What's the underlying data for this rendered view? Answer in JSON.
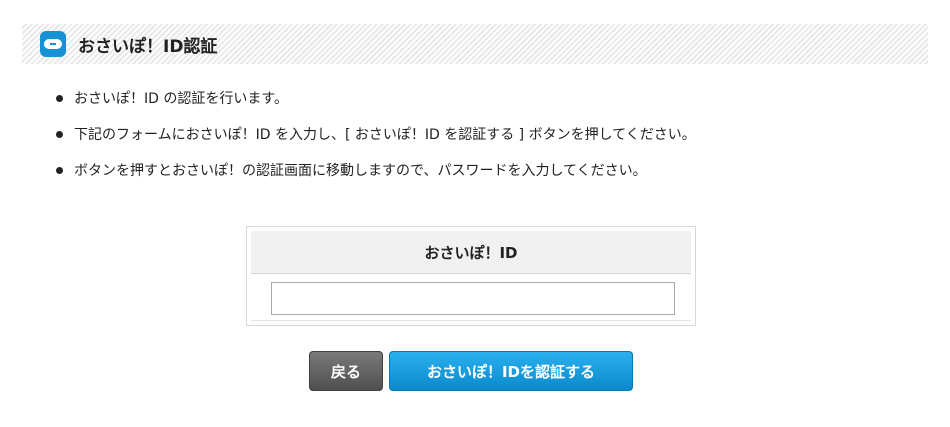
{
  "header": {
    "icon": "speech-bubble-icon",
    "title": "おさいぽ！ID認証",
    "accent_color": "#1592d6"
  },
  "instructions": [
    "おさいぽ！ID の認証を行います。",
    "下記のフォームにおさいぽ！ID を入力し、[ おさいぽ！ID を認証する ] ボタンを押してください。",
    "ボタンを押すとおさいぽ！の認証画面に移動しますので、パスワードを入力してください。"
  ],
  "form": {
    "label": "おさいぽ！ID",
    "value": "",
    "placeholder": ""
  },
  "buttons": {
    "back_label": "戻る",
    "auth_label": "おさいぽ！IDを認証する",
    "back_color": "#5f5f5f",
    "auth_color": "#1592d6"
  }
}
